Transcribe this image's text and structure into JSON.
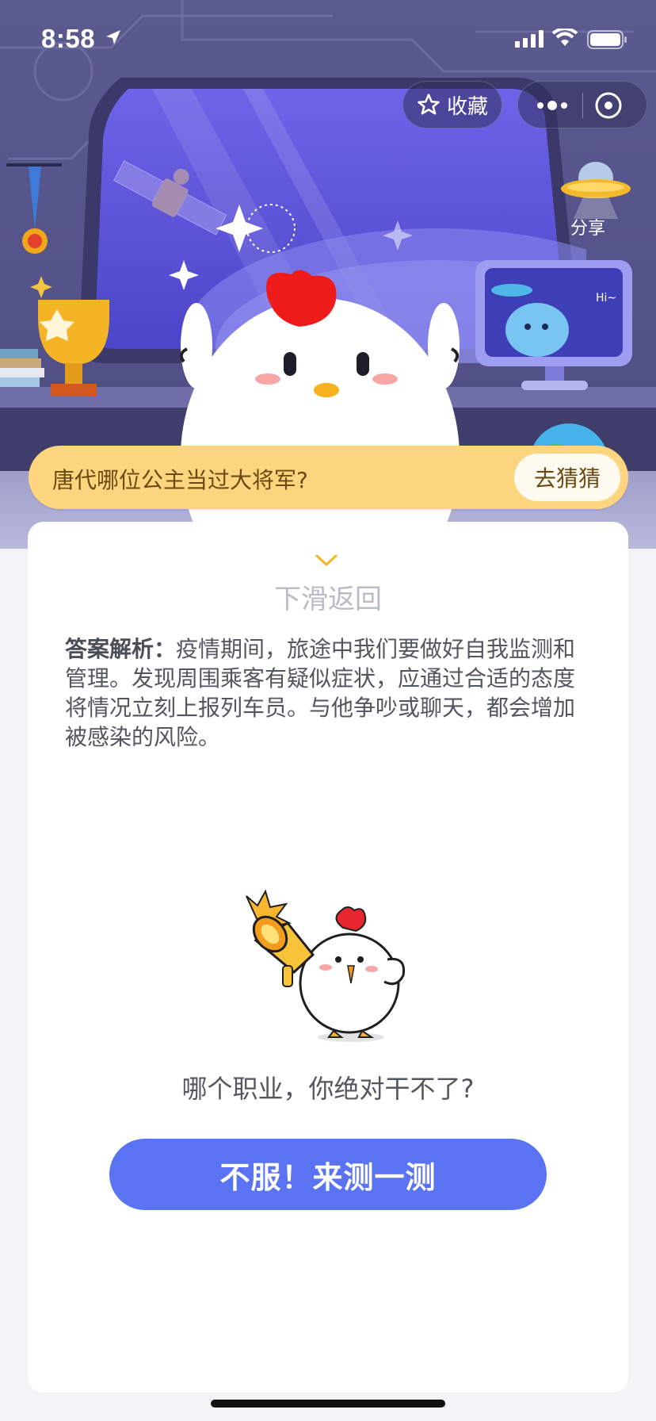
{
  "status_bar": {
    "time": "8:58"
  },
  "header": {
    "favorite_label": "收藏",
    "share_label": "分享"
  },
  "question": {
    "text": "唐代哪位公主当过大将军?",
    "button_label": "去猜猜"
  },
  "card": {
    "swipe_hint": "下滑返回",
    "analysis_label": "答案解析：",
    "analysis_text": "疫情期间，旅途中我们要做好自我监测和管理。发现周围乘客有疑似症状，应通过合适的态度将情况立刻上报列车员。与他争吵或聊天，都会增加被感染的风险。",
    "promo_text": "哪个职业，你绝对干不了?",
    "promo_button": "不服！来测一测"
  },
  "monitor_text": "Hi~",
  "colors": {
    "banner": "#fcd57e",
    "primary_button": "#5a73f2",
    "hero_bg": "#55548a"
  }
}
